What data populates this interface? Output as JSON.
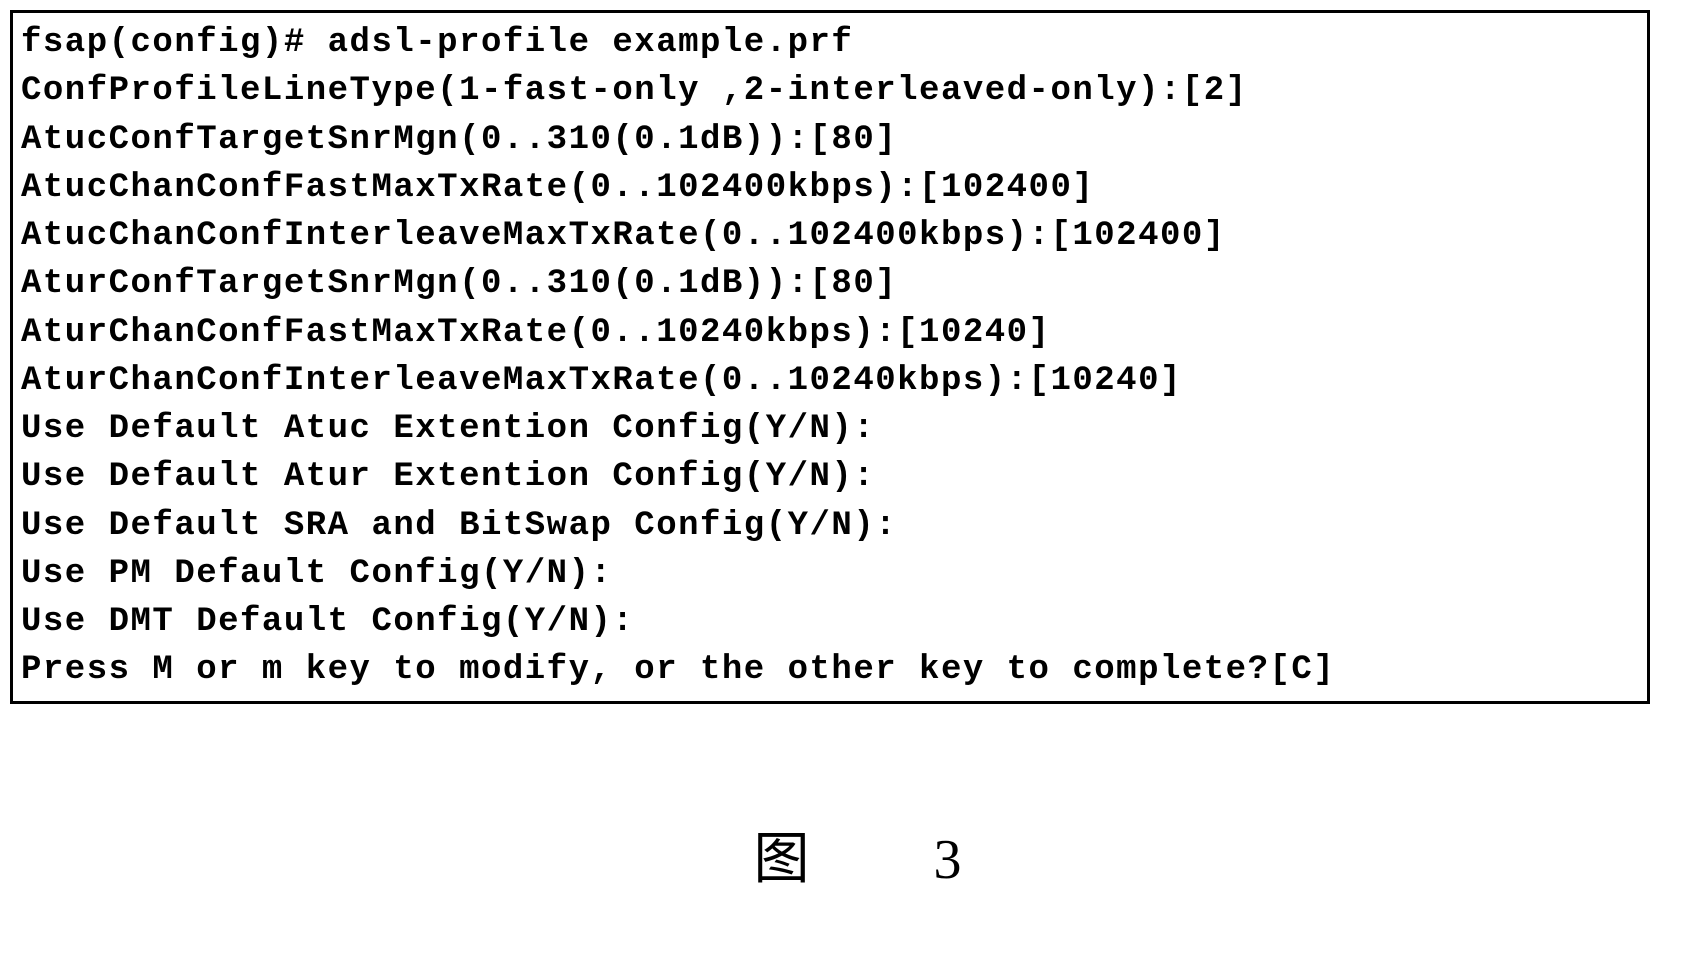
{
  "terminal": {
    "lines": [
      "fsap(config)# adsl-profile example.prf",
      "ConfProfileLineType(1-fast-only ,2-interleaved-only):[2]",
      "AtucConfTargetSnrMgn(0..310(0.1dB)):[80]",
      "AtucChanConfFastMaxTxRate(0..102400kbps):[102400]",
      "AtucChanConfInterleaveMaxTxRate(0..102400kbps):[102400]",
      "AturConfTargetSnrMgn(0..310(0.1dB)):[80]",
      "AturChanConfFastMaxTxRate(0..10240kbps):[10240]",
      "AturChanConfInterleaveMaxTxRate(0..10240kbps):[10240]",
      "Use Default Atuc Extention Config(Y/N):",
      "Use Default Atur Extention Config(Y/N):",
      "Use Default SRA and BitSwap Config(Y/N):",
      "Use PM Default Config(Y/N):",
      "Use DMT Default Config(Y/N):",
      "Press M or m key to modify, or the other key to complete?[C]"
    ]
  },
  "caption": "图 3"
}
